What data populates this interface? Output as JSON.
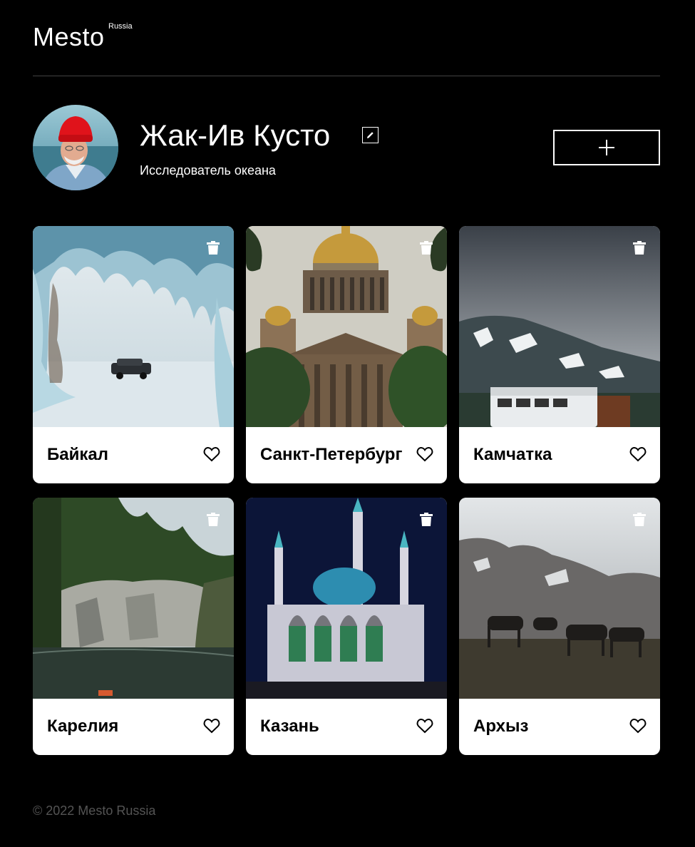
{
  "header": {
    "logo": "Mesto",
    "logo_sup": "Russia"
  },
  "profile": {
    "name": "Жак-Ив Кусто",
    "about": "Исследователь океана",
    "avatar_icon": "avatar-photo",
    "edit_icon": "pencil-icon",
    "add_icon": "plus-icon"
  },
  "cards": [
    {
      "title": "Байкал",
      "liked": false
    },
    {
      "title": "Санкт-Петербург",
      "liked": false
    },
    {
      "title": "Камчатка",
      "liked": false
    },
    {
      "title": "Карелия",
      "liked": false
    },
    {
      "title": "Казань",
      "liked": false
    },
    {
      "title": "Архыз",
      "liked": false
    }
  ],
  "footer": {
    "copyright": "© 2022 Mesto Russia"
  },
  "colors": {
    "background": "#000000",
    "card_background": "#ffffff",
    "divider": "#545454",
    "footer_text": "#545454"
  }
}
